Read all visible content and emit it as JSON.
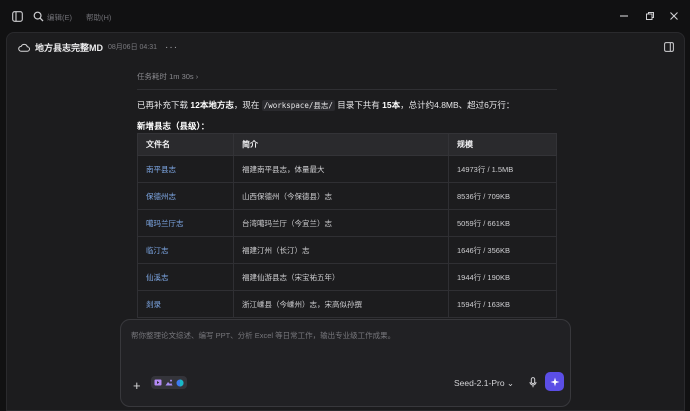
{
  "menu": {
    "edit": "编辑(E)",
    "help": "帮助(H)"
  },
  "doc": {
    "title": "地方县志完整MD",
    "time": "08月06日 04:31",
    "more": "···"
  },
  "task": {
    "elapsed": "任务耗时 1m 30s ›",
    "summary_prefix": "已再补充下载 ",
    "summary_bold1": "12本地方志",
    "summary_mid": "，现在 ",
    "summary_path": "/workspace/县志/",
    "summary_mid2": " 目录下共有 ",
    "summary_bold2": "15本",
    "summary_suffix": "，总计约4.8MB、超过6万行：",
    "subheading": "新增县志（县级）："
  },
  "table": {
    "headers": [
      "文件名",
      "简介",
      "规模"
    ],
    "rows": [
      {
        "name": "南平县志",
        "desc": "福建南平县志，体量最大",
        "size": "14973行 / 1.5MB"
      },
      {
        "name": "保德州志",
        "desc": "山西保德州（今保德县）志",
        "size": "8536行 / 709KB"
      },
      {
        "name": "噶玛兰厅志",
        "desc": "台湾噶玛兰厅（今宜兰）志",
        "size": "5059行 / 661KB"
      },
      {
        "name": "临汀志",
        "desc": "福建汀州（长汀）志",
        "size": "1646行 / 356KB"
      },
      {
        "name": "仙溪志",
        "desc": "福建仙游县志（宋宝祐五年）",
        "size": "1944行 / 190KB"
      },
      {
        "name": "剡录",
        "desc": "浙江嵊县（今嵊州）志，宋高似孙撰",
        "size": "1594行 / 163KB"
      }
    ]
  },
  "composer": {
    "placeholder": "帮你整理论文综述、编写 PPT、分析 Excel 等日常工作，输出专业级工作成果。",
    "model": "Seed-2.1-Pro ⌄"
  },
  "colors": {
    "accent": "#5b4ee6",
    "link": "#7ea8e6"
  }
}
